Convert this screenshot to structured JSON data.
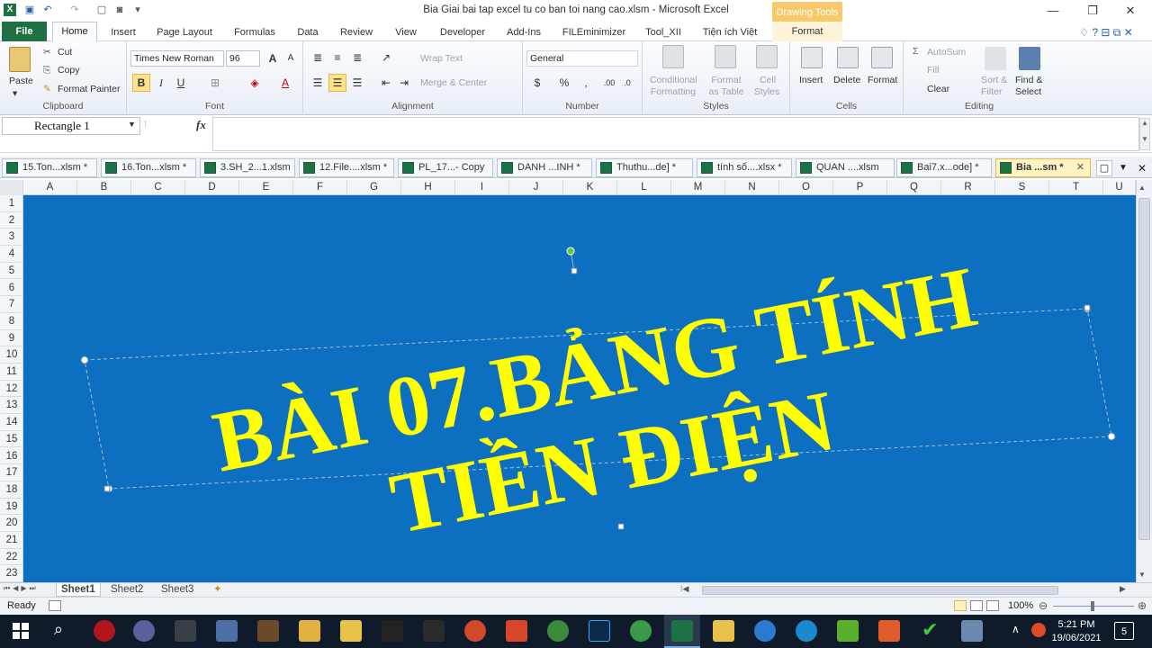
{
  "window": {
    "title": "Bia Giai bai tap excel tu co ban toi nang cao.xlsm  -  Microsoft Excel",
    "context_tab_header": "Drawing Tools"
  },
  "tabs": [
    "File",
    "Home",
    "Insert",
    "Page Layout",
    "Formulas",
    "Data",
    "Review",
    "View",
    "Developer",
    "Add-Ins",
    "FILEminimizer",
    "Tool_XII",
    "Tiện ích Việt",
    "Format"
  ],
  "ribbon": {
    "clipboard": {
      "paste": "Paste",
      "cut": "Cut",
      "copy": "Copy",
      "format_painter": "Format Painter",
      "label": "Clipboard"
    },
    "font": {
      "family": "Times New Roman",
      "size": "96",
      "bold": "B",
      "italic": "I",
      "underline": "U",
      "label": "Font"
    },
    "alignment": {
      "wrap": "Wrap Text",
      "merge": "Merge & Center",
      "label": "Alignment"
    },
    "number": {
      "format": "General",
      "currency": "$",
      "percent": "%",
      "comma": ",",
      "label": "Number"
    },
    "styles": {
      "conditional": [
        "Conditional",
        "Formatting"
      ],
      "table": [
        "Format",
        "as Table"
      ],
      "cell": [
        "Cell",
        "Styles"
      ],
      "label": "Styles"
    },
    "cells": {
      "insert": "Insert",
      "delete": "Delete",
      "format": "Format",
      "label": "Cells"
    },
    "editing": {
      "autosum": "AutoSum",
      "fill": "Fill",
      "clear": "Clear",
      "sort": [
        "Sort &",
        "Filter"
      ],
      "find": [
        "Find &",
        "Select"
      ],
      "label": "Editing"
    }
  },
  "formula_bar": {
    "name_box": "Rectangle 1",
    "fx": "fx",
    "content": ""
  },
  "workbooks": [
    "15.Ton...xlsm *",
    "16.Ton...xlsm *",
    "3.SH_2...1.xlsm",
    "12.File....xlsm *",
    "PL_17...- Copy",
    "DANH ...INH *",
    "Thuthu...de] *",
    "tính số....xlsx *",
    "QUAN ....xlsm",
    "Bai7.x...ode] *",
    "Bia ...sm *"
  ],
  "columns": [
    "A",
    "B",
    "C",
    "D",
    "E",
    "F",
    "G",
    "H",
    "I",
    "J",
    "K",
    "L",
    "M",
    "N",
    "O",
    "P",
    "Q",
    "R",
    "S",
    "T",
    "U"
  ],
  "rows": [
    "1",
    "2",
    "3",
    "4",
    "5",
    "6",
    "7",
    "8",
    "9",
    "10",
    "11",
    "12",
    "13",
    "14",
    "15",
    "16",
    "17",
    "18",
    "19",
    "20",
    "21",
    "22",
    "23"
  ],
  "shape_text": {
    "line1": "BÀI 07.BẢNG TÍNH",
    "line2": "TIỀN ĐIỆN"
  },
  "colors": {
    "canvas": "#0D6FC0",
    "text": "#FFFF00",
    "file_tab": "#1E7145",
    "drawing_tools": "#F7C96A"
  },
  "sheets": [
    "Sheet1",
    "Sheet2",
    "Sheet3"
  ],
  "status": {
    "ready": "Ready",
    "zoom": "100%"
  },
  "taskbar": {
    "time": "5:21 PM",
    "date": "19/06/2021",
    "notifications": "5"
  }
}
